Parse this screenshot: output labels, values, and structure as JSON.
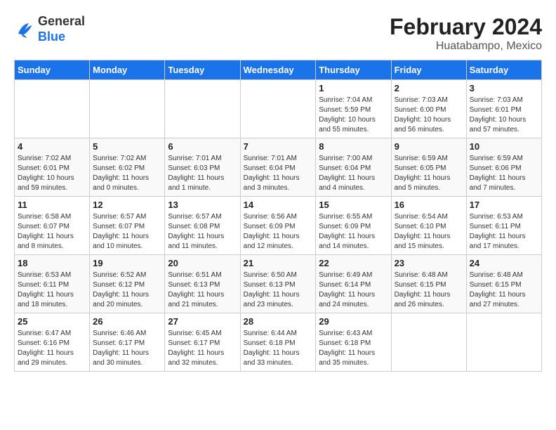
{
  "header": {
    "logo_line1": "General",
    "logo_line2": "Blue",
    "title": "February 2024",
    "subtitle": "Huatabampo, Mexico"
  },
  "calendar": {
    "days_of_week": [
      "Sunday",
      "Monday",
      "Tuesday",
      "Wednesday",
      "Thursday",
      "Friday",
      "Saturday"
    ],
    "weeks": [
      [
        {
          "day": "",
          "info": ""
        },
        {
          "day": "",
          "info": ""
        },
        {
          "day": "",
          "info": ""
        },
        {
          "day": "",
          "info": ""
        },
        {
          "day": "1",
          "info": "Sunrise: 7:04 AM\nSunset: 5:59 PM\nDaylight: 10 hours and 55 minutes."
        },
        {
          "day": "2",
          "info": "Sunrise: 7:03 AM\nSunset: 6:00 PM\nDaylight: 10 hours and 56 minutes."
        },
        {
          "day": "3",
          "info": "Sunrise: 7:03 AM\nSunset: 6:01 PM\nDaylight: 10 hours and 57 minutes."
        }
      ],
      [
        {
          "day": "4",
          "info": "Sunrise: 7:02 AM\nSunset: 6:01 PM\nDaylight: 10 hours and 59 minutes."
        },
        {
          "day": "5",
          "info": "Sunrise: 7:02 AM\nSunset: 6:02 PM\nDaylight: 11 hours and 0 minutes."
        },
        {
          "day": "6",
          "info": "Sunrise: 7:01 AM\nSunset: 6:03 PM\nDaylight: 11 hours and 1 minute."
        },
        {
          "day": "7",
          "info": "Sunrise: 7:01 AM\nSunset: 6:04 PM\nDaylight: 11 hours and 3 minutes."
        },
        {
          "day": "8",
          "info": "Sunrise: 7:00 AM\nSunset: 6:04 PM\nDaylight: 11 hours and 4 minutes."
        },
        {
          "day": "9",
          "info": "Sunrise: 6:59 AM\nSunset: 6:05 PM\nDaylight: 11 hours and 5 minutes."
        },
        {
          "day": "10",
          "info": "Sunrise: 6:59 AM\nSunset: 6:06 PM\nDaylight: 11 hours and 7 minutes."
        }
      ],
      [
        {
          "day": "11",
          "info": "Sunrise: 6:58 AM\nSunset: 6:07 PM\nDaylight: 11 hours and 8 minutes."
        },
        {
          "day": "12",
          "info": "Sunrise: 6:57 AM\nSunset: 6:07 PM\nDaylight: 11 hours and 10 minutes."
        },
        {
          "day": "13",
          "info": "Sunrise: 6:57 AM\nSunset: 6:08 PM\nDaylight: 11 hours and 11 minutes."
        },
        {
          "day": "14",
          "info": "Sunrise: 6:56 AM\nSunset: 6:09 PM\nDaylight: 11 hours and 12 minutes."
        },
        {
          "day": "15",
          "info": "Sunrise: 6:55 AM\nSunset: 6:09 PM\nDaylight: 11 hours and 14 minutes."
        },
        {
          "day": "16",
          "info": "Sunrise: 6:54 AM\nSunset: 6:10 PM\nDaylight: 11 hours and 15 minutes."
        },
        {
          "day": "17",
          "info": "Sunrise: 6:53 AM\nSunset: 6:11 PM\nDaylight: 11 hours and 17 minutes."
        }
      ],
      [
        {
          "day": "18",
          "info": "Sunrise: 6:53 AM\nSunset: 6:11 PM\nDaylight: 11 hours and 18 minutes."
        },
        {
          "day": "19",
          "info": "Sunrise: 6:52 AM\nSunset: 6:12 PM\nDaylight: 11 hours and 20 minutes."
        },
        {
          "day": "20",
          "info": "Sunrise: 6:51 AM\nSunset: 6:13 PM\nDaylight: 11 hours and 21 minutes."
        },
        {
          "day": "21",
          "info": "Sunrise: 6:50 AM\nSunset: 6:13 PM\nDaylight: 11 hours and 23 minutes."
        },
        {
          "day": "22",
          "info": "Sunrise: 6:49 AM\nSunset: 6:14 PM\nDaylight: 11 hours and 24 minutes."
        },
        {
          "day": "23",
          "info": "Sunrise: 6:48 AM\nSunset: 6:15 PM\nDaylight: 11 hours and 26 minutes."
        },
        {
          "day": "24",
          "info": "Sunrise: 6:48 AM\nSunset: 6:15 PM\nDaylight: 11 hours and 27 minutes."
        }
      ],
      [
        {
          "day": "25",
          "info": "Sunrise: 6:47 AM\nSunset: 6:16 PM\nDaylight: 11 hours and 29 minutes."
        },
        {
          "day": "26",
          "info": "Sunrise: 6:46 AM\nSunset: 6:17 PM\nDaylight: 11 hours and 30 minutes."
        },
        {
          "day": "27",
          "info": "Sunrise: 6:45 AM\nSunset: 6:17 PM\nDaylight: 11 hours and 32 minutes."
        },
        {
          "day": "28",
          "info": "Sunrise: 6:44 AM\nSunset: 6:18 PM\nDaylight: 11 hours and 33 minutes."
        },
        {
          "day": "29",
          "info": "Sunrise: 6:43 AM\nSunset: 6:18 PM\nDaylight: 11 hours and 35 minutes."
        },
        {
          "day": "",
          "info": ""
        },
        {
          "day": "",
          "info": ""
        }
      ]
    ]
  }
}
